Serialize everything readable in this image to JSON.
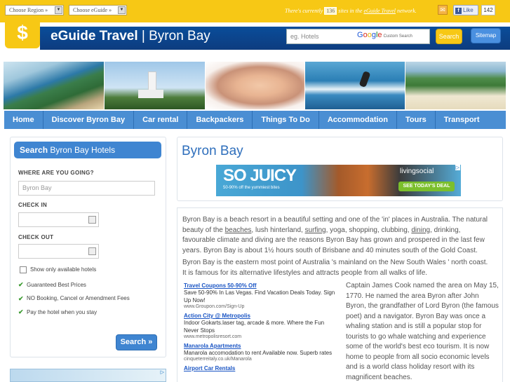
{
  "topbar": {
    "region_select": "Choose Region »",
    "eguide_select": "Choose eGuide »",
    "note_prefix": "There's currently",
    "sites_count": "136",
    "note_mid": "sites in the",
    "note_link": "eGuide Travel",
    "note_suffix": "network.",
    "like_label": "Like",
    "like_count": "142"
  },
  "header": {
    "brand": "eGuide Travel",
    "separator": " | ",
    "location": "Byron Bay",
    "search_placeholder": "eg. Hotels",
    "google_custom": "Custom Search",
    "search_button": "Search",
    "sitemap_button": "Sitemap"
  },
  "nav": {
    "items": [
      "Home",
      "Discover Byron Bay",
      "Car rental",
      "Backpackers",
      "Things To Do",
      "Accommodation",
      "Tours",
      "Transport"
    ]
  },
  "hotel_search": {
    "heading_bold": "Search",
    "heading_rest": " Byron Bay Hotels",
    "where_label": "WHERE ARE YOU GOING?",
    "where_value": "Byron Bay",
    "checkin_label": "CHECK IN",
    "checkout_label": "CHECK OUT",
    "available_only": "Show only available hotels",
    "benefits": [
      "Guaranteed Best Prices",
      "NO Booking, Cancel or Amendment Fees",
      "Pay the hotel when you stay"
    ],
    "search_button": "Search »"
  },
  "main": {
    "title": "Byron Bay",
    "banner": {
      "headline": "SO JUICY",
      "sub": "50-90% off  the yummiest bites",
      "brand": "livingsocial",
      "cta": "SEE TODAY'S DEAL"
    },
    "intro_1": "Byron Bay is a beach resort in a beautiful setting and one of the 'in' places in Australia. The natural beauty of the",
    "intro_link_beaches": "beaches",
    "intro_2": ", lush hinterland,",
    "intro_link_surfing": "surfing",
    "intro_3": ", yoga, shopping, clubbing,",
    "intro_link_dining": "dining",
    "intro_4": ", drinking, favourable climate and diving are the reasons Byron Bay has grown and prospered in the last few years. Byron Bay is about 1½ hours south of Brisbane and 40 minutes south of the Gold Coast.",
    "para_2": "Byron Bay is the eastern most point of Australia 's mainland on the New South Wales ' north coast. It is famous for its alternative lifestyles and attracts people from all walks of life.",
    "ads": [
      {
        "title": "Travel Coupons 50-90% Off",
        "body": "Save 50-90% In Las Vegas. Find Vacation Deals Today. Sign Up Now!",
        "url": "www.Groupon.com/Sign-Up"
      },
      {
        "title": "Action City @ Metropolis",
        "body": "Indoor Gokarts.laser tag, arcade & more. Where the Fun Never Stops",
        "url": "www.metropolisresort.com"
      },
      {
        "title": "Manarola Apartments",
        "body": "Manarola accomodation to rent Available now. Superb rates",
        "url": "cinqueterreitaly.co.uk/Manarola"
      },
      {
        "title": "Airport Car Rentals",
        "body": "",
        "url": ""
      }
    ],
    "cook_para": "Captain James Cook named the area on May 15, 1770. He named the area Byron after John Byron, the grandfather of Lord Byron (the famous poet) and a navigator. Byron Bay was once a whaling station and is still a popular stop for tourists to go whale watching and experience some of the world's best eco tourism. It is now home to people from all socio economic levels and is a world class holiday resort with its magnificent beaches."
  },
  "colors": {
    "top_yellow": "#f7c815",
    "header_blue": "#0a4d9a",
    "nav_blue": "#4a8ed3",
    "title_blue": "#2f6fbc"
  }
}
